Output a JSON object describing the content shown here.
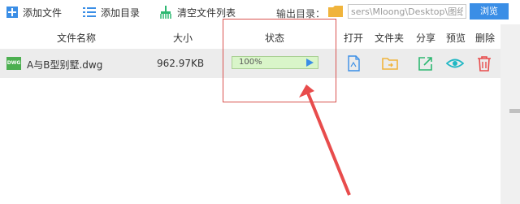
{
  "toolbar": {
    "add_file_label": "添加文件",
    "add_dir_label": "添加目录",
    "clear_label": "清空文件列表",
    "output_dir_label": "输出目录：",
    "output_path_value": "sers\\Mloong\\Desktop\\图纸",
    "browse_label": "浏览"
  },
  "table": {
    "headers": {
      "filename": "文件名称",
      "size": "大小",
      "status": "状态",
      "open": "打开",
      "folder": "文件夹",
      "share": "分享",
      "preview": "预览",
      "delete": "删除"
    },
    "rows": [
      {
        "icon_text": "DWG",
        "filename": "A与B型别墅.dwg",
        "size": "962.97KB",
        "progress": "100%",
        "progress_fraction": 1.0
      }
    ]
  },
  "colors": {
    "accent": "#3a8ee6",
    "folder": "#f0b43c",
    "share": "#2eb872",
    "preview": "#1fb7c4",
    "delete": "#e84c4c",
    "highlight": "#d9534f",
    "progress_bg": "#d9f5c9"
  },
  "icons": {
    "add_file": "plus-icon",
    "add_dir": "list-icon",
    "clear": "broom-icon",
    "output_folder": "folder-icon",
    "open": "document-icon",
    "folder": "folder-icon",
    "share": "share-icon",
    "preview": "eye-icon",
    "delete": "trash-icon",
    "start": "play-icon"
  }
}
